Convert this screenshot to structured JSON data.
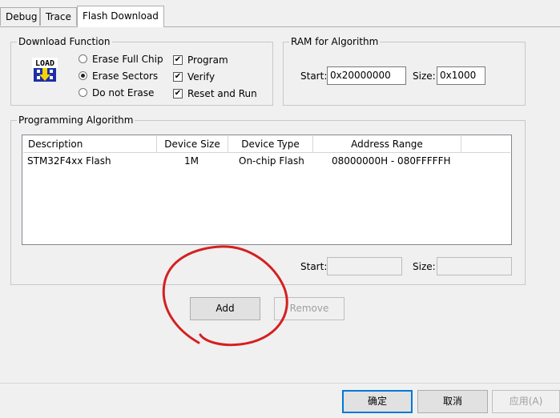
{
  "tabs": [
    {
      "label": "Debug"
    },
    {
      "label": "Trace"
    },
    {
      "label": "Flash Download"
    }
  ],
  "download_function": {
    "title": "Download Function",
    "radios": [
      {
        "label": "Erase Full Chip",
        "selected": false
      },
      {
        "label": "Erase Sectors",
        "selected": true
      },
      {
        "label": "Do not Erase",
        "selected": false
      }
    ],
    "checks": [
      {
        "label": "Program",
        "checked": true
      },
      {
        "label": "Verify",
        "checked": true
      },
      {
        "label": "Reset and Run",
        "checked": true
      }
    ],
    "icon_text": "LOAD"
  },
  "ram": {
    "title": "RAM for Algorithm",
    "start_label": "Start:",
    "start_value": "0x20000000",
    "size_label": "Size:",
    "size_value": "0x1000"
  },
  "programming": {
    "title": "Programming Algorithm",
    "columns": [
      "Description",
      "Device Size",
      "Device Type",
      "Address Range"
    ],
    "rows": [
      {
        "description": "STM32F4xx Flash",
        "size": "1M",
        "type": "On-chip Flash",
        "range": "08000000H - 080FFFFFH"
      }
    ],
    "start_label": "Start:",
    "start_value": "",
    "size_label": "Size:",
    "size_value": ""
  },
  "buttons": {
    "add": "Add",
    "remove": "Remove"
  },
  "dialog_buttons": {
    "ok": "确定",
    "cancel": "取消",
    "apply": "应用(A)"
  },
  "annotation_color": "#d42020"
}
